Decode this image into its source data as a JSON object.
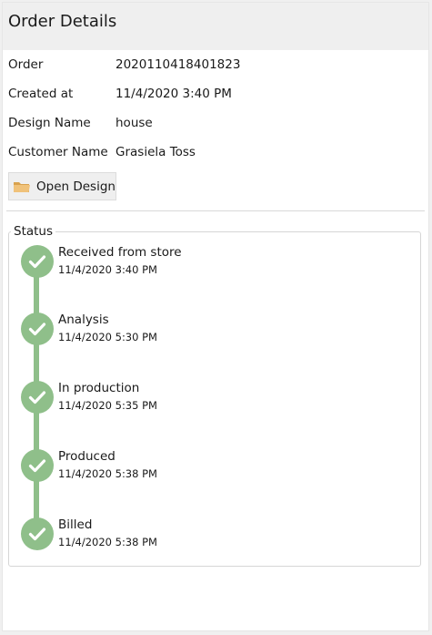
{
  "window": {
    "title": "Order Details"
  },
  "order": {
    "order_label": "Order",
    "order_value": "2020110418401823",
    "created_label": "Created at",
    "created_value": "11/4/2020 3:40 PM",
    "design_label": "Design Name",
    "design_value": "house",
    "customer_label": "Customer Name",
    "customer_value": "Grasiela Toss"
  },
  "actions": {
    "open_design_label": "Open Design",
    "open_design_icon": "folder-icon"
  },
  "status": {
    "legend": "Status",
    "steps": [
      {
        "title": "Received from store",
        "time": "11/4/2020 3:40 PM",
        "icon": "check-icon"
      },
      {
        "title": "Analysis",
        "time": "11/4/2020 5:30 PM",
        "icon": "check-icon"
      },
      {
        "title": "In production",
        "time": "11/4/2020 5:35 PM",
        "icon": "check-icon"
      },
      {
        "title": "Produced",
        "time": "11/4/2020 5:38 PM",
        "icon": "check-icon"
      },
      {
        "title": "Billed",
        "time": "11/4/2020 5:38 PM",
        "icon": "check-icon"
      }
    ]
  },
  "colors": {
    "step_complete": "#8fbf8a",
    "header_background": "#efefef",
    "folder": "#e8b86a"
  }
}
